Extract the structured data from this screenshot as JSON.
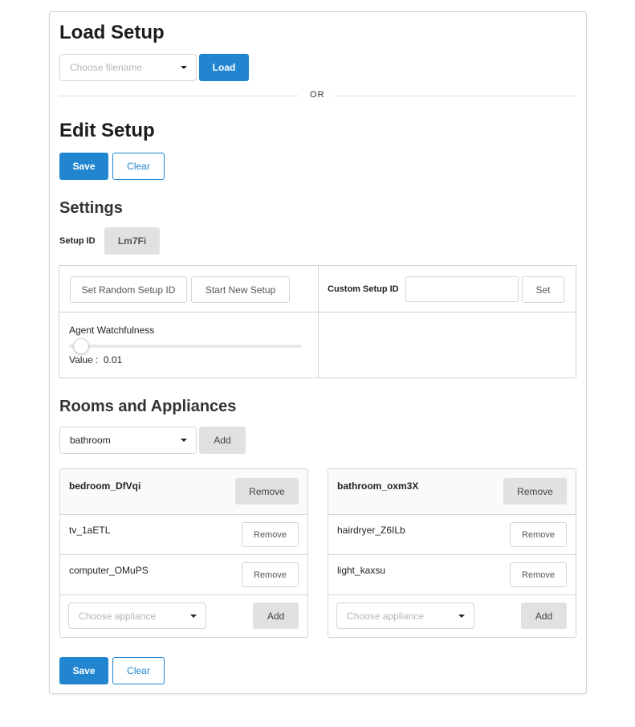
{
  "load_setup": {
    "title": "Load Setup",
    "filename_placeholder": "Choose filename",
    "load_button": "Load",
    "or_text": "OR"
  },
  "edit_setup": {
    "title": "Edit Setup",
    "save_button": "Save",
    "clear_button": "Clear"
  },
  "settings": {
    "title": "Settings",
    "setup_id_label": "Setup ID",
    "setup_id_value": "Lm7Fi",
    "random_id_button": "Set Random Setup ID",
    "new_setup_button": "Start New Setup",
    "custom_id_label": "Custom Setup ID",
    "custom_id_value": "",
    "set_button": "Set",
    "watchfulness_label": "Agent Watchfulness",
    "value_label": "Value :",
    "watchfulness_value": "0.01",
    "watchfulness_level": 0.01
  },
  "rooms": {
    "title": "Rooms and Appliances",
    "selected_room_type": "bathroom",
    "add_button": "Add",
    "room_list": [
      {
        "name": "bedroom_DfVqi",
        "remove_label": "Remove",
        "appliances": [
          {
            "name": "tv_1aETL",
            "remove_label": "Remove"
          },
          {
            "name": "computer_OMuPS",
            "remove_label": "Remove"
          }
        ],
        "appliance_placeholder": "Choose appliance",
        "add_label": "Add"
      },
      {
        "name": "bathroom_oxm3X",
        "remove_label": "Remove",
        "appliances": [
          {
            "name": "hairdryer_Z6ILb",
            "remove_label": "Remove"
          },
          {
            "name": "light_kaxsu",
            "remove_label": "Remove"
          }
        ],
        "appliance_placeholder": "Choose appliance",
        "add_label": "Add"
      }
    ]
  },
  "footer": {
    "save_button": "Save",
    "clear_button": "Clear"
  },
  "colors": {
    "primary": "#2185d0",
    "grey_button": "#e0e1e2",
    "border": "#d4d4d5"
  }
}
